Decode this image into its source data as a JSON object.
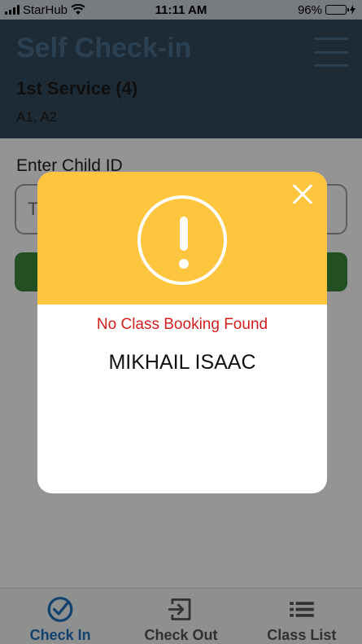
{
  "status_bar": {
    "carrier": "StarHub",
    "time": "11:11 AM",
    "battery": "96%",
    "battery_level": 0.96
  },
  "header": {
    "title": "Self Check-in",
    "service": "1st Service (4)",
    "classes": "A1, A2"
  },
  "form": {
    "label": "Enter Child ID",
    "placeholder": "T"
  },
  "modal": {
    "message": "No Class Booking Found",
    "child_name": "MIKHAIL ISAAC"
  },
  "tabs": [
    {
      "label": "Check In",
      "icon": "check-circle-icon",
      "active": true
    },
    {
      "label": "Check Out",
      "icon": "exit-icon",
      "active": false
    },
    {
      "label": "Class List",
      "icon": "list-icon",
      "active": false
    }
  ],
  "colors": {
    "header": "#324a5e",
    "modal_header": "#fec53f",
    "error_text": "#d11f1f",
    "active_tab": "#1e73be",
    "button": "#3b8a3d"
  }
}
